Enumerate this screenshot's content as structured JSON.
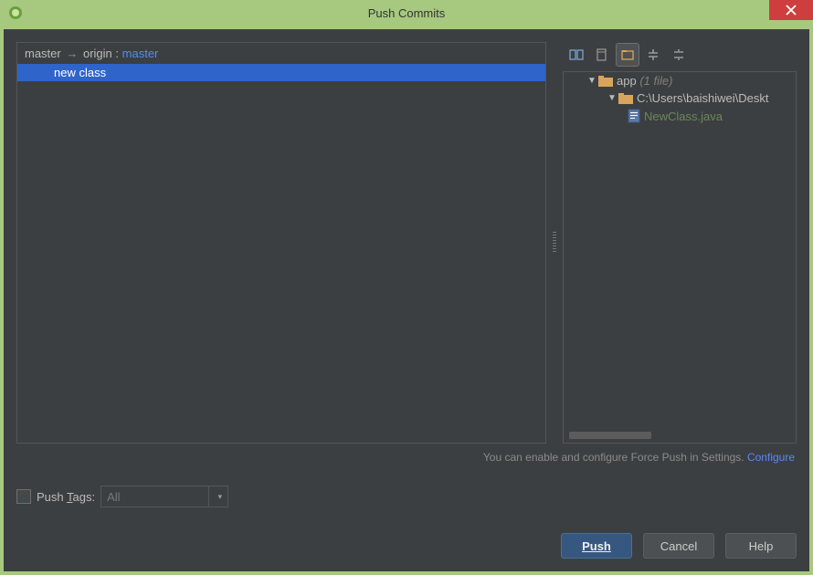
{
  "window": {
    "title": "Push Commits"
  },
  "branch": {
    "local": "master",
    "arrow": "→",
    "remote_label": "origin",
    "separator": ":",
    "remote_branch": "master"
  },
  "commits": [
    {
      "message": "new class"
    }
  ],
  "tree": {
    "root": {
      "name": "app",
      "count": "(1 file)"
    },
    "path": {
      "name": "C:\\Users\\baishiwei\\Deskt"
    },
    "file": {
      "name": "NewClass.java"
    }
  },
  "hint": {
    "text": "You can enable and configure Force Push in Settings. ",
    "link": "Configure"
  },
  "pushtags": {
    "label": "Push Tags:",
    "value": "All"
  },
  "buttons": {
    "push": "Push",
    "cancel": "Cancel",
    "help": "Help"
  }
}
